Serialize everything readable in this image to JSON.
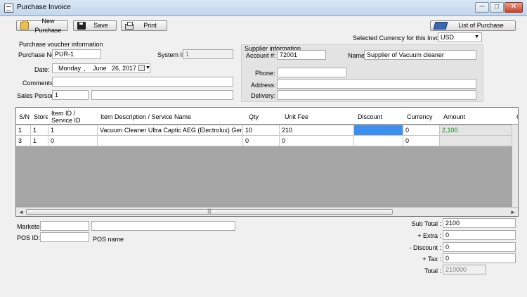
{
  "window": {
    "title": "Purchase Invoice",
    "controls": [
      "─",
      "□",
      "✕"
    ]
  },
  "toolbar": {
    "new_purchase": "New Purchase",
    "save": "Save",
    "print": "Print",
    "list_of_purchase": "List of Purchase"
  },
  "currency": {
    "label": "Selected Currency for this Invoice:",
    "value": "USD"
  },
  "voucher": {
    "section_title": "Purchase voucher information",
    "purchase_no_label": "Purchase No:",
    "purchase_no": "PUR-1",
    "system_id_label": "System ID:",
    "system_id": "1",
    "date_label": "Date:",
    "date_day": "Monday",
    "date_sep": ",",
    "date_month": "June",
    "date_daynum": "26, 2017",
    "comments_label": "Comments:",
    "comments": "",
    "sales_person_label": "Sales Person:",
    "sales_person_id": "1",
    "sales_person_name": ""
  },
  "supplier": {
    "section_title": "Supplier information",
    "account_label": "Account #:",
    "account": "72001",
    "name_label": "Name:",
    "name": "Supplier of Vacuum cleaner",
    "phone_label": "Phone:",
    "phone": "",
    "address_label": "Address:",
    "address": "",
    "delivery_label": "Delivery:",
    "delivery": ""
  },
  "grid": {
    "headers": {
      "sn": "S/N",
      "store": "Store",
      "item_id_1": "Item ID /",
      "item_id_2": "Service ID",
      "desc": "Item Description  / Service Name",
      "qty": "Qty",
      "fee": "Unit Fee",
      "discount": "Discount",
      "currency": "Currency",
      "amount": "Amount",
      "extra": "C"
    },
    "rows": [
      {
        "sn": "1",
        "store": "1",
        "item_id": "1",
        "desc": "Vacuum Cleaner Ultra Captic AEG (Electrolux) Ger...",
        "qty": "10",
        "fee": "210",
        "discount": "",
        "currency": "0",
        "amount": "2,100"
      },
      {
        "sn": "3",
        "store": "1",
        "item_id": "0",
        "desc": "",
        "qty": "0",
        "fee": "0",
        "discount": "",
        "currency": "0",
        "amount": ""
      }
    ],
    "scroll_grip": "|||"
  },
  "bottom": {
    "marketer_label": "Marketer:",
    "marketer_id": "",
    "marketer_name": "",
    "pos_id_label": "POS ID:",
    "pos_id": "",
    "pos_name_label": "POS name"
  },
  "totals": {
    "subtotal_label": "Sub Total :",
    "subtotal": "2100",
    "extra_label": "+ Extra :",
    "extra": "0",
    "discount_label": "- Discount :",
    "discount": "0",
    "tax_label": "+ Tax :",
    "tax": "0",
    "total_label": "Total :",
    "total": "210000"
  },
  "colors": {
    "selected_cell": "#3d8fef",
    "amount_text": "#138a13"
  }
}
